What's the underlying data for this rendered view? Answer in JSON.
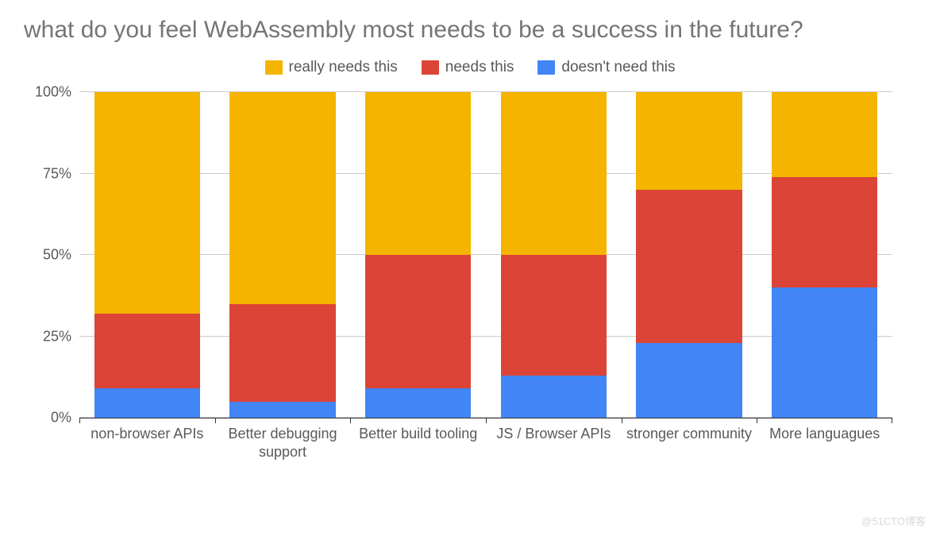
{
  "chart_data": {
    "type": "bar",
    "title": "what do you feel WebAssembly most needs to be a success in the future?",
    "ylabel": "",
    "xlabel": "",
    "ylim": [
      0,
      100
    ],
    "y_ticks": [
      "0%",
      "25%",
      "50%",
      "75%",
      "100%"
    ],
    "categories": [
      "non-browser APIs",
      "Better debugging support",
      "Better build tooling",
      "JS / Browser APIs",
      "stronger community",
      "More languagues"
    ],
    "series": [
      {
        "name": "doesn't need this",
        "color": "#4285f4",
        "values": [
          9,
          5,
          9,
          13,
          23,
          40
        ]
      },
      {
        "name": "needs this",
        "color": "#db4437",
        "values": [
          23,
          30,
          41,
          37,
          47,
          34
        ]
      },
      {
        "name": "really needs this",
        "color": "#f4b400",
        "values": [
          68,
          65,
          50,
          50,
          30,
          26
        ]
      }
    ],
    "legend_order": [
      "really needs this",
      "needs this",
      "doesn't need this"
    ],
    "stacked": true,
    "legend_position": "top"
  },
  "watermark": "@51CTO博客"
}
